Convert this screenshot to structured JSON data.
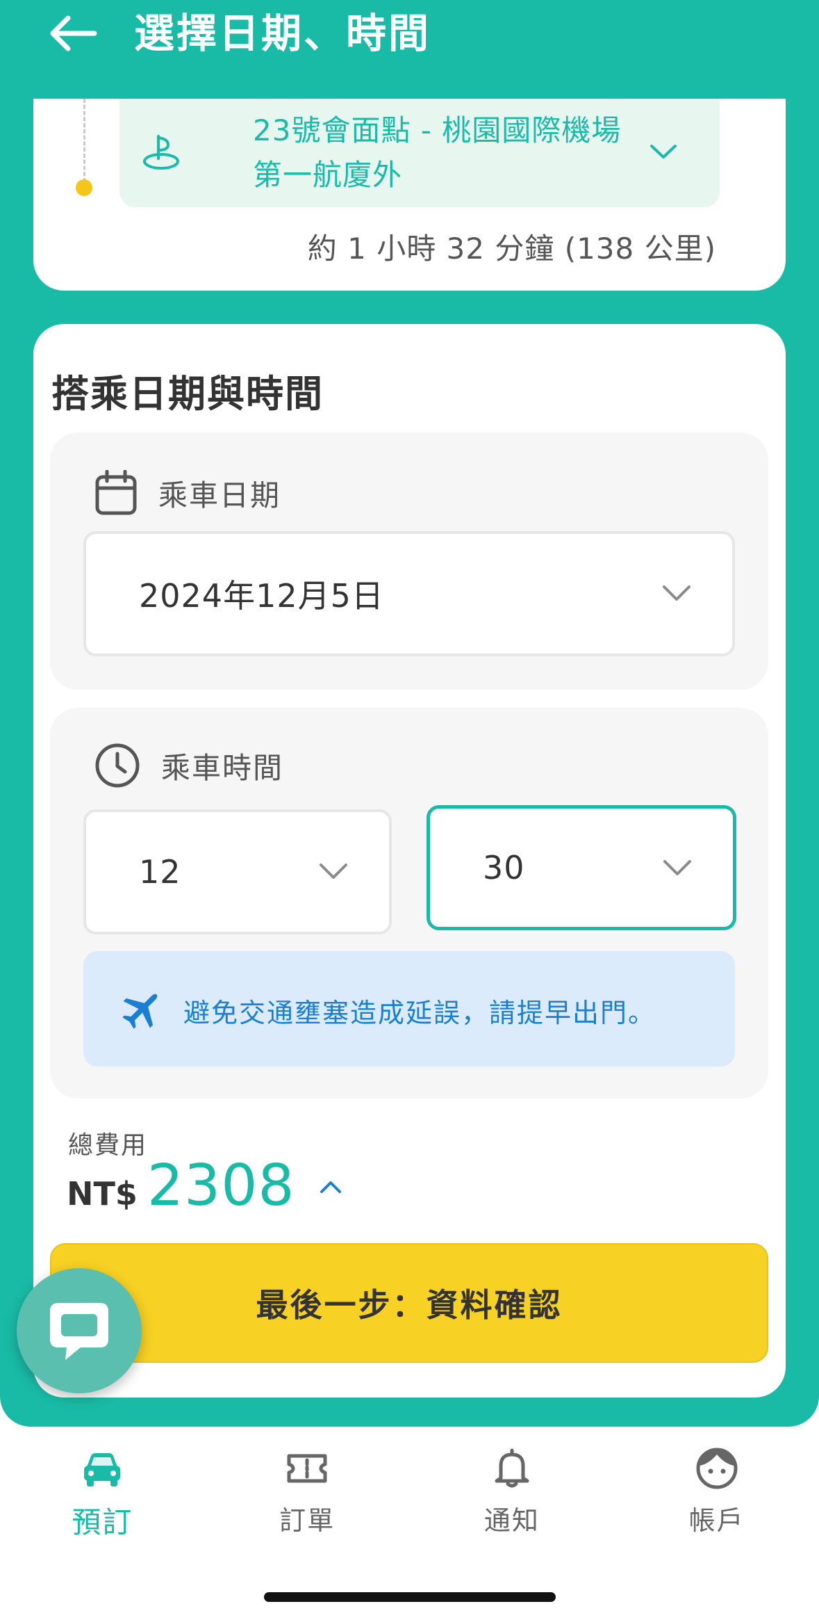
{
  "header": {
    "title": "選擇日期、時間"
  },
  "route": {
    "destination": "23號會面點 - 桃園國際機場第一航廈外",
    "eta": "約 1 小時 32 分鐘 (138 公里)"
  },
  "booking": {
    "section_title": "搭乘日期與時間",
    "date": {
      "label": "乘車日期",
      "value": "2024年12月5日"
    },
    "time": {
      "label": "乘車時間",
      "hour": "12",
      "minute": "30"
    },
    "notice": "避免交通壅塞造成延誤，請提早出門。",
    "fee": {
      "label": "總費用",
      "currency": "NT$",
      "amount": "2308"
    },
    "confirm_label": "最後一步：資料確認"
  },
  "nav": {
    "items": [
      {
        "label": "預訂",
        "icon": "car-icon",
        "active": true
      },
      {
        "label": "訂單",
        "icon": "ticket-icon",
        "active": false
      },
      {
        "label": "通知",
        "icon": "bell-icon",
        "active": false
      },
      {
        "label": "帳戶",
        "icon": "face-icon",
        "active": false
      }
    ]
  },
  "colors": {
    "accent": "#19bba6",
    "button": "#f7d123",
    "notice_bg": "#dbebfb",
    "notice_text": "#1a7fd1",
    "marker": "#f5c518"
  }
}
